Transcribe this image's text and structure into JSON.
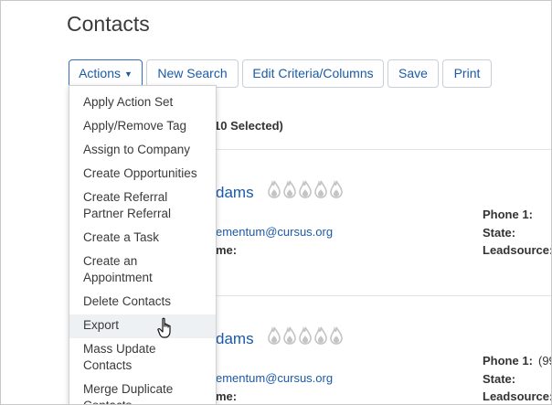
{
  "page": {
    "title": "Contacts"
  },
  "toolbar": {
    "actions_label": "Actions",
    "new_search_label": "New Search",
    "edit_criteria_label": "Edit Criteria/Columns",
    "save_label": "Save",
    "print_label": "Print"
  },
  "selection": {
    "text": "10 Selected)"
  },
  "actions_menu": {
    "items": [
      {
        "label": "Apply Action Set"
      },
      {
        "label": "Apply/Remove Tag"
      },
      {
        "label": "Assign to Company"
      },
      {
        "label": "Create Opportunities"
      },
      {
        "label": "Create Referral Partner Referral"
      },
      {
        "label": "Create a Task"
      },
      {
        "label": "Create an Appointment"
      },
      {
        "label": "Delete Contacts"
      },
      {
        "label": "Export"
      },
      {
        "label": "Mass Update Contacts"
      },
      {
        "label": "Merge Duplicate Contacts"
      }
    ],
    "hovered_index": 8
  },
  "contacts": [
    {
      "name": "dams",
      "email": "ementum@cursus.org",
      "field_partial": "me:",
      "phone_label": "Phone 1:",
      "phone_value": "",
      "state_label": "State:",
      "leadsource_label": "Leadsource:"
    },
    {
      "name": "dams",
      "email": "ementum@cursus.org",
      "field_partial": "me:",
      "phone_label": "Phone 1:",
      "phone_value": "(99",
      "state_label": "State:",
      "leadsource_label": "Leadsource:"
    }
  ],
  "colors": {
    "link": "#1a5aa8",
    "flame": "#c4c4c4",
    "menu_hover": "#eef1f4"
  },
  "icons": {
    "score": "flame-icon",
    "cursor": "hand-pointer-icon",
    "actions_caret": "chevron-down-icon"
  }
}
